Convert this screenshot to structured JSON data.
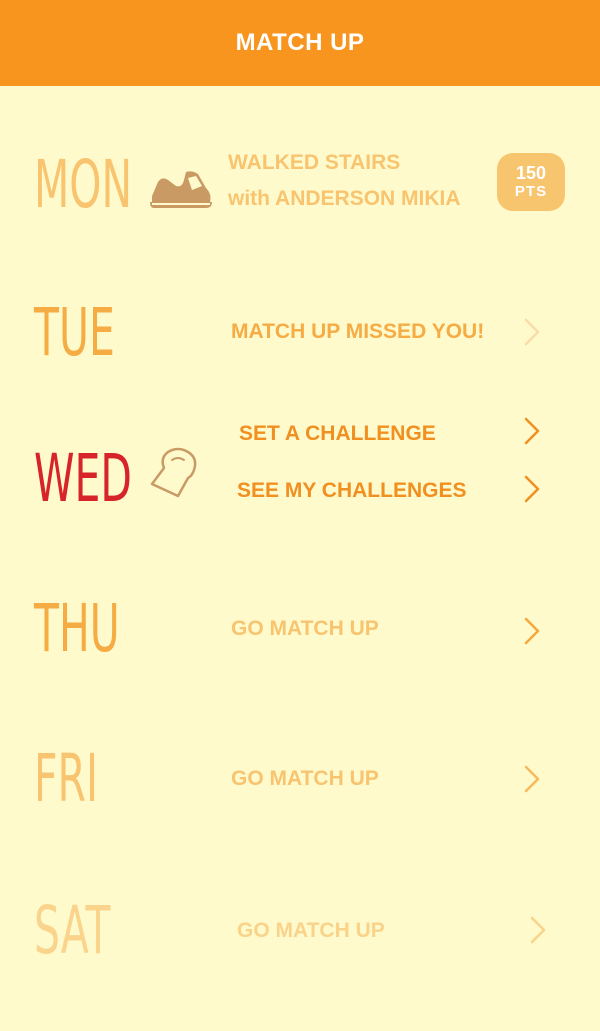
{
  "header": {
    "title": "MATCH UP"
  },
  "colors": {
    "header_bg": "#F7951E",
    "background": "#FFFACC",
    "accent_red": "#D6242A"
  },
  "days": {
    "mon": {
      "label": "MON",
      "icon": "sneaker-icon",
      "activity_line1": "WALKED STAIRS",
      "activity_line2": "with ANDERSON MIKIA",
      "points_value": "150",
      "points_unit": "PTS"
    },
    "tue": {
      "label": "TUE",
      "message": "MATCH UP MISSED YOU!"
    },
    "wed": {
      "label": "WED",
      "icon": "toast-icon",
      "action1": "SET A CHALLENGE",
      "action2": "SEE MY CHALLENGES"
    },
    "thu": {
      "label": "THU",
      "action": "GO MATCH UP"
    },
    "fri": {
      "label": "FRI",
      "action": "GO MATCH UP"
    },
    "sat": {
      "label": "SAT",
      "action": "GO MATCH UP"
    }
  }
}
